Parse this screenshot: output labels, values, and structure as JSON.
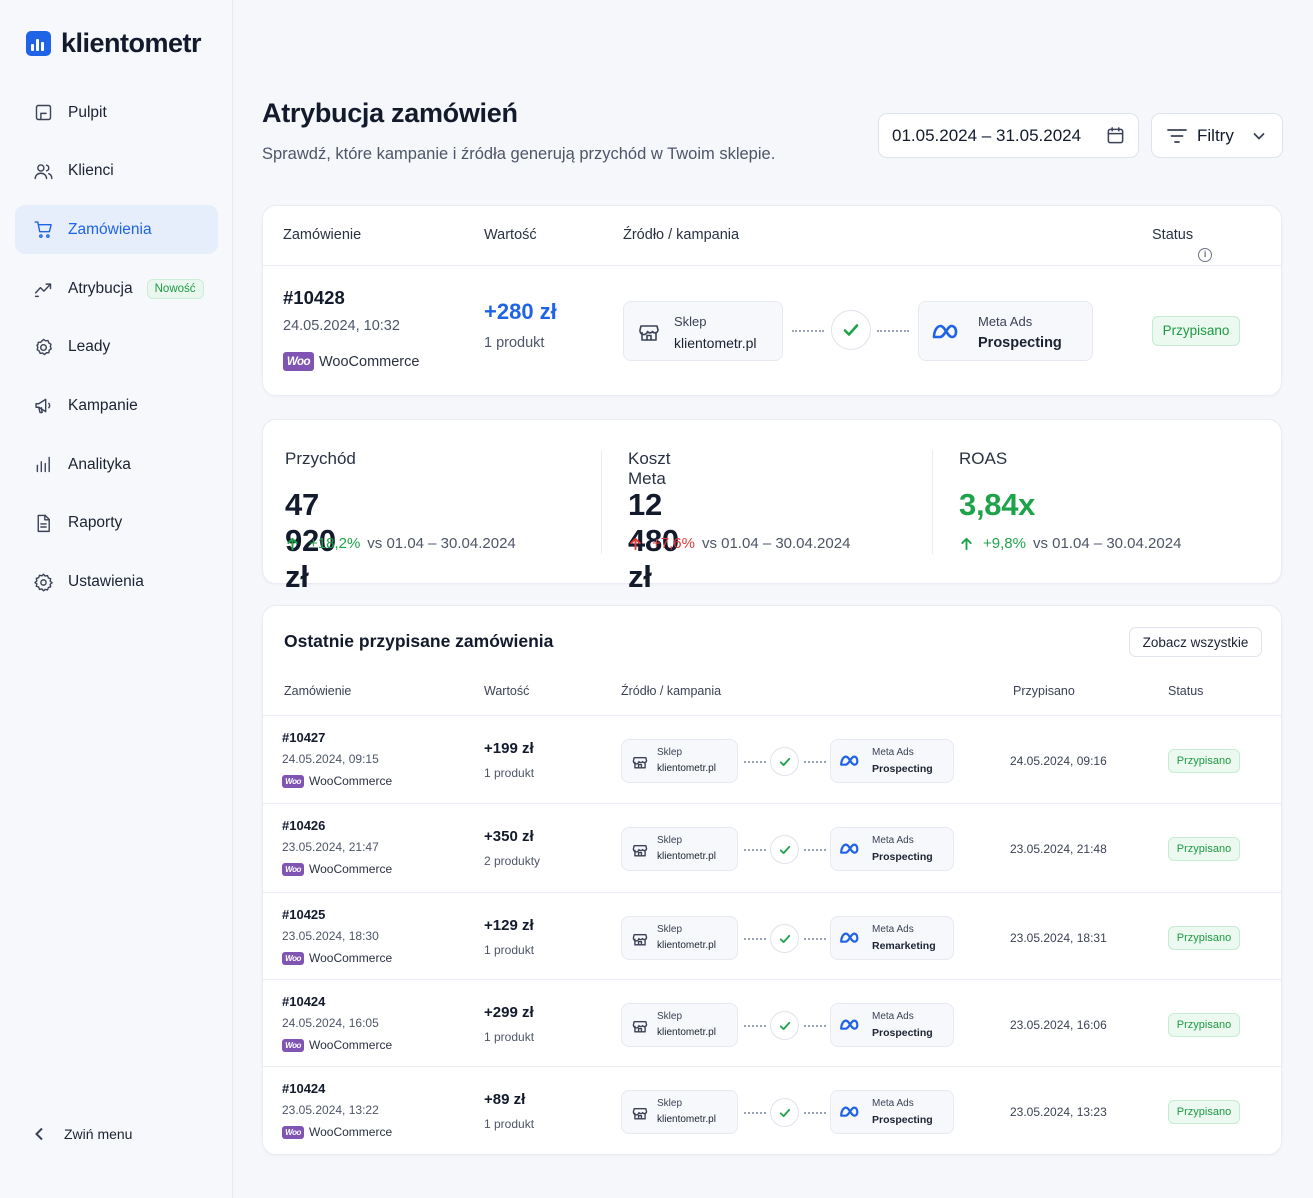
{
  "app": {
    "name": "klientometr"
  },
  "sidebar": {
    "items": [
      {
        "label": "Pulpit",
        "icon": "dashboard-icon"
      },
      {
        "label": "Klienci",
        "icon": "users-icon"
      },
      {
        "label": "Zamówienia",
        "icon": "cart-icon",
        "active": true
      },
      {
        "label": "Atrybucja",
        "icon": "attribution-icon",
        "badge": "Nowość"
      },
      {
        "label": "Leady",
        "icon": "leads-icon"
      },
      {
        "label": "Kampanie",
        "icon": "megaphone-icon"
      },
      {
        "label": "Analityka",
        "icon": "analytics-icon"
      },
      {
        "label": "Raporty",
        "icon": "report-icon"
      },
      {
        "label": "Ustawienia",
        "icon": "gear-icon"
      }
    ],
    "collapse_label": "Zwiń menu"
  },
  "header": {
    "title": "Atrybucja zamówień",
    "subtitle": "Sprawdź, które kampanie i źródła generują przychód w Twoim sklepie.",
    "date_range": "01.05.2024 – 31.05.2024",
    "filters_label": "Filtry"
  },
  "featured": {
    "columns": {
      "order": "Zamówienie",
      "value": "Wartość",
      "source": "Źródło / kampania",
      "status": "Status"
    },
    "order": {
      "id": "#10428",
      "date": "24.05.2024, 10:32",
      "platform": "WooCommerce",
      "platform_logo": "Woo",
      "value": "+280 zł",
      "qty": "1 produkt",
      "source_l1": "Sklep",
      "source_l2": "klientometr.pl",
      "campaign_l1": "Meta Ads",
      "campaign_l2": "Prospecting",
      "status": "Przypisano"
    }
  },
  "stats": [
    {
      "label": "Przychód",
      "value": "47 920 zł",
      "change": "+18,2%",
      "direction": "up",
      "compare": "vs 01.04 – 30.04.2024"
    },
    {
      "label": "Koszt Meta",
      "value": "12 480 zł",
      "change": "+7,6%",
      "direction": "down",
      "compare": "vs 01.04 – 30.04.2024"
    },
    {
      "label": "ROAS",
      "value": "3,84x",
      "change": "+9,8%",
      "direction": "up",
      "compare": "vs 01.04 – 30.04.2024",
      "highlight": true
    }
  ],
  "recent": {
    "title": "Ostatnie przypisane zamówienia",
    "see_all": "Zobacz wszystkie",
    "columns": {
      "order": "Zamówienie",
      "value": "Wartość",
      "source": "Źródło / kampania",
      "assigned": "Przypisano",
      "status": "Status"
    },
    "rows": [
      {
        "id": "#10427",
        "date": "24.05.2024, 09:15",
        "platform": "WooCommerce",
        "value": "+199 zł",
        "qty": "1 produkt",
        "source_l1": "Sklep",
        "source_l2": "klientometr.pl",
        "campaign_l1": "Meta Ads",
        "campaign_l2": "Prospecting",
        "assigned": "24.05.2024, 09:16",
        "status": "Przypisano"
      },
      {
        "id": "#10426",
        "date": "23.05.2024, 21:47",
        "platform": "WooCommerce",
        "value": "+350 zł",
        "qty": "2 produkty",
        "source_l1": "Sklep",
        "source_l2": "klientometr.pl",
        "campaign_l1": "Meta Ads",
        "campaign_l2": "Prospecting",
        "assigned": "23.05.2024, 21:48",
        "status": "Przypisano"
      },
      {
        "id": "#10425",
        "date": "23.05.2024, 18:30",
        "platform": "WooCommerce",
        "value": "+129 zł",
        "qty": "1 produkt",
        "source_l1": "Sklep",
        "source_l2": "klientometr.pl",
        "campaign_l1": "Meta Ads",
        "campaign_l2": "Remarketing",
        "assigned": "23.05.2024, 18:31",
        "status": "Przypisano"
      },
      {
        "id": "#10424",
        "date": "24.05.2024, 16:05",
        "platform": "WooCommerce",
        "value": "+299 zł",
        "qty": "1 produkt",
        "source_l1": "Sklep",
        "source_l2": "klientometr.pl",
        "campaign_l1": "Meta Ads",
        "campaign_l2": "Prospecting",
        "assigned": "23.05.2024, 16:06",
        "status": "Przypisano"
      },
      {
        "id": "#10424",
        "date": "23.05.2024, 13:22",
        "platform": "WooCommerce",
        "value": "+89 zł",
        "qty": "1 produkt",
        "source_l1": "Sklep",
        "source_l2": "klientometr.pl",
        "campaign_l1": "Meta Ads",
        "campaign_l2": "Prospecting",
        "assigned": "23.05.2024, 13:23",
        "status": "Przypisano"
      }
    ]
  },
  "colors": {
    "accent": "#1f63e6",
    "success": "#1fa34a",
    "danger": "#e33b3b",
    "woo": "#7f54b3",
    "meta": "#1f63e6"
  }
}
